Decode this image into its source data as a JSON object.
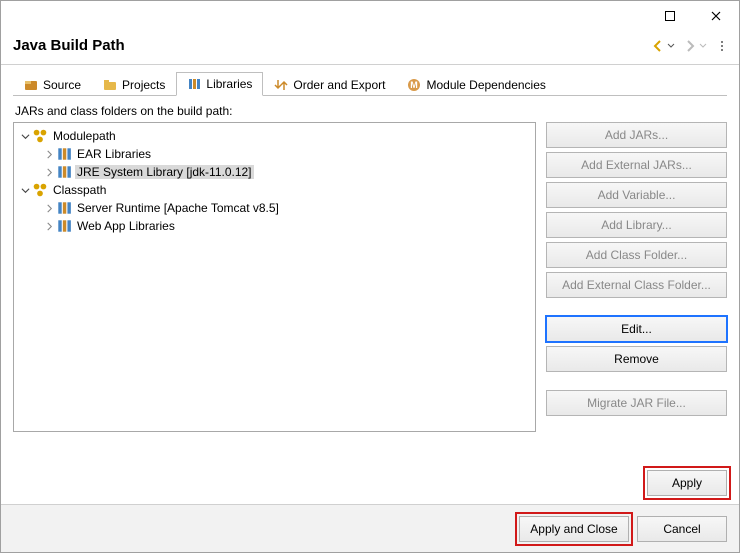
{
  "header": {
    "title": "Java Build Path"
  },
  "tabs": {
    "source": "Source",
    "projects": "Projects",
    "libraries": "Libraries",
    "order": "Order and Export",
    "modules": "Module Dependencies"
  },
  "description": "JARs and class folders on the build path:",
  "tree": {
    "modulepath": "Modulepath",
    "ear": "EAR Libraries",
    "jre": "JRE System Library [jdk-11.0.12]",
    "classpath": "Classpath",
    "server": "Server Runtime [Apache Tomcat v8.5]",
    "webapp": "Web App Libraries"
  },
  "buttons": {
    "add_jars": "Add JARs...",
    "add_ext_jars": "Add External JARs...",
    "add_variable": "Add Variable...",
    "add_library": "Add Library...",
    "add_class_folder": "Add Class Folder...",
    "add_ext_class_folder": "Add External Class Folder...",
    "edit": "Edit...",
    "remove": "Remove",
    "migrate": "Migrate JAR File..."
  },
  "footer": {
    "apply": "Apply",
    "apply_close": "Apply and Close",
    "cancel": "Cancel"
  }
}
